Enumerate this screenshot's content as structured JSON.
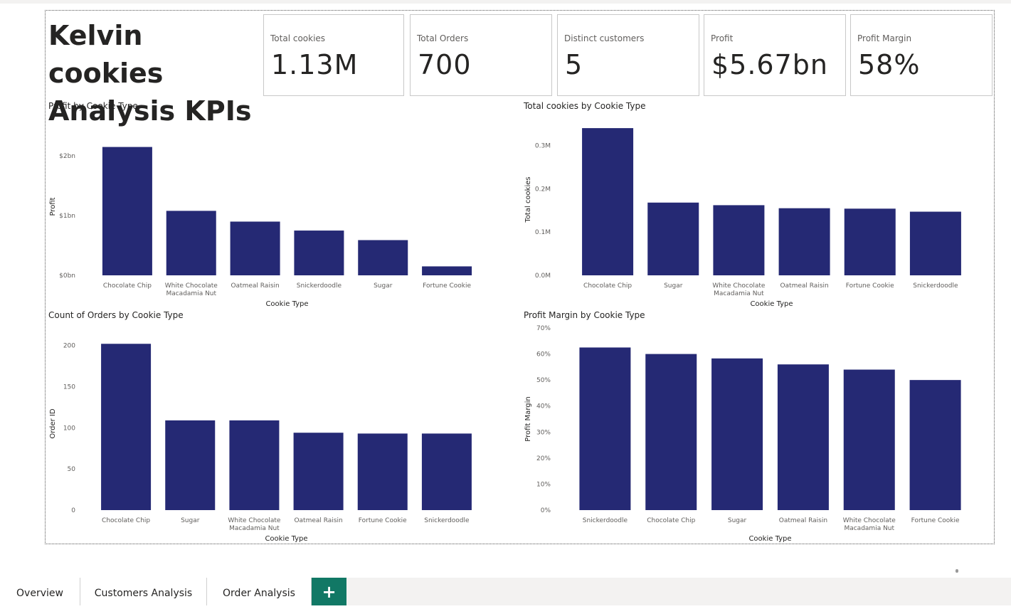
{
  "report": {
    "title": "Kelvin cookies\nAnalysis  KPIs"
  },
  "kpis": [
    {
      "label": "Total cookies",
      "value": "1.13M"
    },
    {
      "label": "Total Orders",
      "value": "700"
    },
    {
      "label": "Distinct customers",
      "value": "5"
    },
    {
      "label": "Profit",
      "value": "$5.67bn"
    },
    {
      "label": "Profit Margin",
      "value": "58%"
    }
  ],
  "tabs": {
    "items": [
      "Overview",
      "Customers Analysis",
      "Order Analysis"
    ],
    "active": "Overview",
    "add_label": "+"
  },
  "colors": {
    "bar": "#252974",
    "add_tab": "#117865"
  },
  "chart_data": [
    {
      "type": "bar",
      "title": "Profit by Cookie Type",
      "xlabel": "Cookie Type",
      "ylabel": "Profit",
      "categories": [
        "Chocolate Chip",
        "White Chocolate\nMacadamia Nut",
        "Oatmeal Raisin",
        "Snickerdoodle",
        "Sugar",
        "Fortune Cookie"
      ],
      "values": [
        2.15,
        1.08,
        0.9,
        0.75,
        0.59,
        0.15
      ],
      "ylim": [
        0,
        2.3
      ],
      "yticks": [
        0,
        1,
        2
      ],
      "ytick_labels": [
        "$0bn",
        "$1bn",
        "$2bn"
      ]
    },
    {
      "type": "bar",
      "title": "Total cookies by Cookie Type",
      "xlabel": "Cookie Type",
      "ylabel": "Total cookies",
      "categories": [
        "Chocolate Chip",
        "Sugar",
        "White Chocolate\nMacadamia Nut",
        "Oatmeal Raisin",
        "Fortune Cookie",
        "Snickerdoodle"
      ],
      "values": [
        0.34,
        0.168,
        0.162,
        0.155,
        0.154,
        0.147
      ],
      "ylim": [
        0,
        0.35
      ],
      "yticks": [
        0,
        0.1,
        0.2,
        0.3
      ],
      "ytick_labels": [
        "0.0M",
        "0.1M",
        "0.2M",
        "0.3M"
      ]
    },
    {
      "type": "bar",
      "title": "Count of Orders by Cookie Type",
      "xlabel": "Cookie Type",
      "ylabel": "Order ID",
      "categories": [
        "Chocolate Chip",
        "Sugar",
        "White Chocolate\nMacadamia Nut",
        "Oatmeal Raisin",
        "Fortune Cookie",
        "Snickerdoodle"
      ],
      "values": [
        202,
        109,
        109,
        94,
        93,
        93
      ],
      "ylim": [
        0,
        210
      ],
      "yticks": [
        0,
        50,
        100,
        150,
        200
      ],
      "ytick_labels": [
        "0",
        "50",
        "100",
        "150",
        "200"
      ]
    },
    {
      "type": "bar",
      "title": "Profit Margin by Cookie Type",
      "xlabel": "Cookie Type",
      "ylabel": "Profit Margin",
      "categories": [
        "Snickerdoodle",
        "Chocolate Chip",
        "Sugar",
        "Oatmeal Raisin",
        "White Chocolate\nMacadamia Nut",
        "Fortune Cookie"
      ],
      "values": [
        62.5,
        60,
        58.3,
        56,
        54,
        50
      ],
      "ylim": [
        0,
        70
      ],
      "yticks": [
        0,
        10,
        20,
        30,
        40,
        50,
        60,
        70
      ],
      "ytick_labels": [
        "0%",
        "10%",
        "20%",
        "30%",
        "40%",
        "50%",
        "60%",
        "70%"
      ]
    }
  ]
}
